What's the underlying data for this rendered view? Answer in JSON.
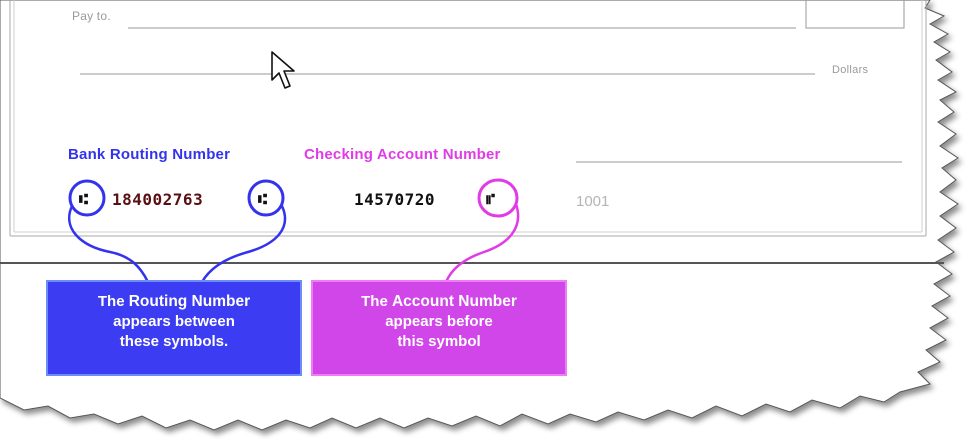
{
  "check": {
    "pay_to_label": "Pay to.",
    "dollars_label": "Dollars",
    "routing_heading": "Bank Routing Number",
    "account_heading": "Checking Account Number",
    "routing_number": "184002763",
    "account_number": "14570720",
    "check_number": "1001"
  },
  "callouts": {
    "routing": {
      "line1_prefix": "The ",
      "line1_strong": "Routing Number",
      "line2": "appears between",
      "line3": "these symbols."
    },
    "account": {
      "line1_prefix": "The ",
      "line1_strong": "Account Number",
      "line2": "appears before",
      "line3": "this symbol"
    }
  },
  "colors": {
    "routing_accent": "#3333ee",
    "account_accent": "#e13be8",
    "routing_box": "#3c3cf2",
    "account_box": "#d046e8"
  },
  "icons": {
    "cursor": "mouse-pointer-icon",
    "transit_symbol": "micr-transit-symbol-icon",
    "on_us_symbol": "micr-on-us-symbol-icon"
  }
}
